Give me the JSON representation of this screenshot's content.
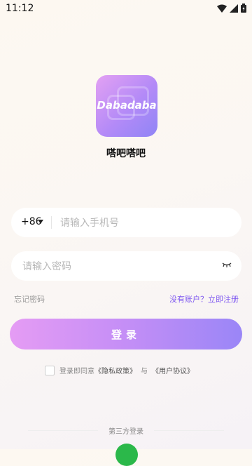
{
  "status_bar": {
    "time": "11:12"
  },
  "app": {
    "logo_text": "Dabadaba",
    "name": "嗒吧嗒吧"
  },
  "login_form": {
    "country_code": "+86",
    "phone_placeholder": "请输入手机号",
    "password_placeholder": "请输入密码",
    "forgot_password": "忘记密码",
    "register_link": "没有账户？立即注册",
    "login_button": "登录"
  },
  "agreement": {
    "prefix": "登录即同意",
    "privacy": "《隐私政策》",
    "conjunction": "与",
    "terms": "《用户协议》"
  },
  "third_party": {
    "label": "第三方登录"
  },
  "colors": {
    "accent": "#7f59f0",
    "gradient_start": "#e59cf4",
    "gradient_end": "#9a86f7",
    "wechat": "#2bb84a"
  }
}
